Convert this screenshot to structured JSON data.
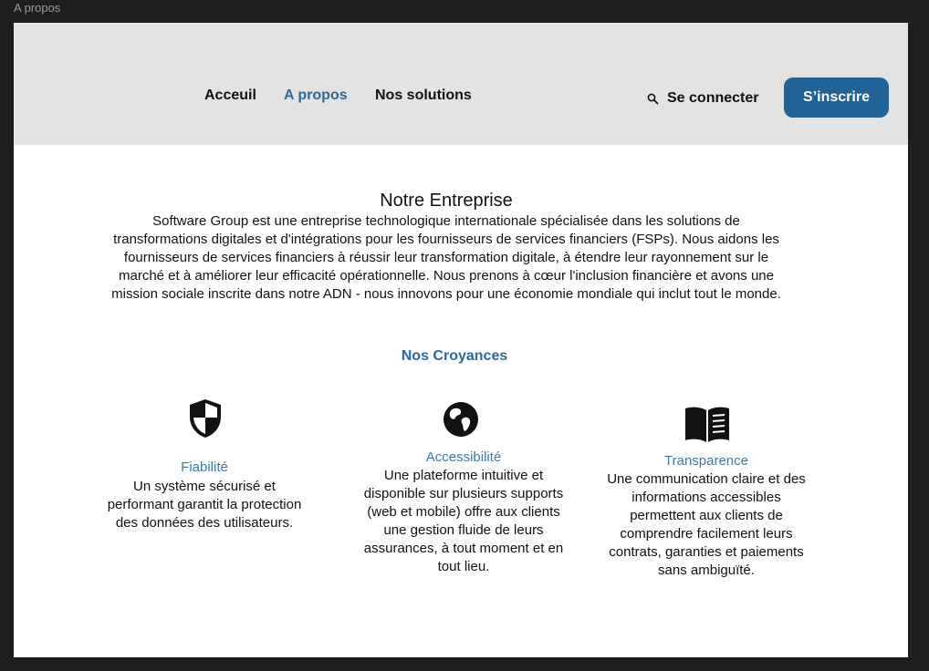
{
  "frame": {
    "label": "A propos"
  },
  "nav": {
    "items": [
      {
        "label": "Acceuil"
      },
      {
        "label": "A propos"
      },
      {
        "label": "Nos solutions"
      }
    ],
    "login_label": "Se connecter",
    "signup_label": "S’inscrire"
  },
  "about": {
    "title": "Notre Entreprise",
    "text": "Software Group est une entreprise technologique internationale spécialisée dans  les solutions de transformations digitales et d'intégrations pour les  fournisseurs de services financiers (FSPs). Nous aidons les fournisseurs de services financiers à réussir leur transformation digitale, à  étendre leur rayonnement sur le marché et à améliorer leur efficacité  opérationnelle. Nous prenons à cœur l'inclusion financière et avons une  mission sociale inscrite dans notre ADN - nous innovons pour une  économie mondiale qui inclut tout le monde."
  },
  "beliefs": {
    "title": "Nos Croyances",
    "items": [
      {
        "icon": "shield-icon",
        "title": "Fiabilité",
        "text": "Un système sécurisé et performant garantit la protection des données des utilisateurs."
      },
      {
        "icon": "globe-icon",
        "title": "Accessibilité",
        "text": "Une plateforme intuitive et disponible sur plusieurs supports (web et mobile) offre aux clients une gestion fluide de leurs assurances, à tout moment et en tout lieu."
      },
      {
        "icon": "book-icon",
        "title": "Transparence",
        "text": "Une communication claire et des informations accessibles permettent aux clients de comprendre facilement leurs contrats, garanties et paiements sans ambiguïté."
      }
    ]
  },
  "colors": {
    "accent": "#226294",
    "link_active": "#2d6897",
    "header_bg": "#e3e3e3",
    "canvas_bg": "#1e1e1e"
  }
}
